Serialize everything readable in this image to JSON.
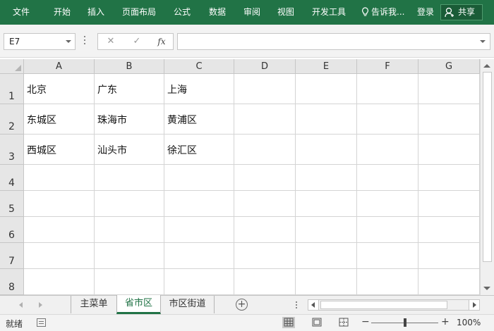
{
  "ribbon": {
    "tabs": [
      "文件",
      "开始",
      "插入",
      "页面布局",
      "公式",
      "数据",
      "审阅",
      "视图",
      "开发工具"
    ],
    "tell_me": "告诉我...",
    "login": "登录",
    "share": "共享",
    "color": "#217346"
  },
  "formula_bar": {
    "name_box": "E7",
    "cancel": "✕",
    "enter": "✓",
    "fx": "fx",
    "value": ""
  },
  "grid": {
    "columns": [
      "A",
      "B",
      "C",
      "D",
      "E",
      "F",
      "G"
    ],
    "rows": [
      "1",
      "2",
      "3",
      "4",
      "5",
      "6",
      "7",
      "8"
    ],
    "cells": [
      [
        "北京",
        "广东",
        "上海",
        "",
        "",
        "",
        ""
      ],
      [
        "东城区",
        "珠海市",
        "黄浦区",
        "",
        "",
        "",
        ""
      ],
      [
        "西城区",
        "汕头市",
        "徐汇区",
        "",
        "",
        "",
        ""
      ],
      [
        "",
        "",
        "",
        "",
        "",
        "",
        ""
      ],
      [
        "",
        "",
        "",
        "",
        "",
        "",
        ""
      ],
      [
        "",
        "",
        "",
        "",
        "",
        "",
        ""
      ],
      [
        "",
        "",
        "",
        "",
        "",
        "",
        ""
      ],
      [
        "",
        "",
        "",
        "",
        "",
        "",
        ""
      ]
    ]
  },
  "sheets": {
    "tabs": [
      "主菜单",
      "省市区",
      "市区街道"
    ],
    "active": 1,
    "add": "+"
  },
  "status_bar": {
    "ready": "就绪",
    "zoom_minus": "−",
    "zoom_plus": "+",
    "zoom": "100%",
    "zoom_fraction": 0.5
  }
}
